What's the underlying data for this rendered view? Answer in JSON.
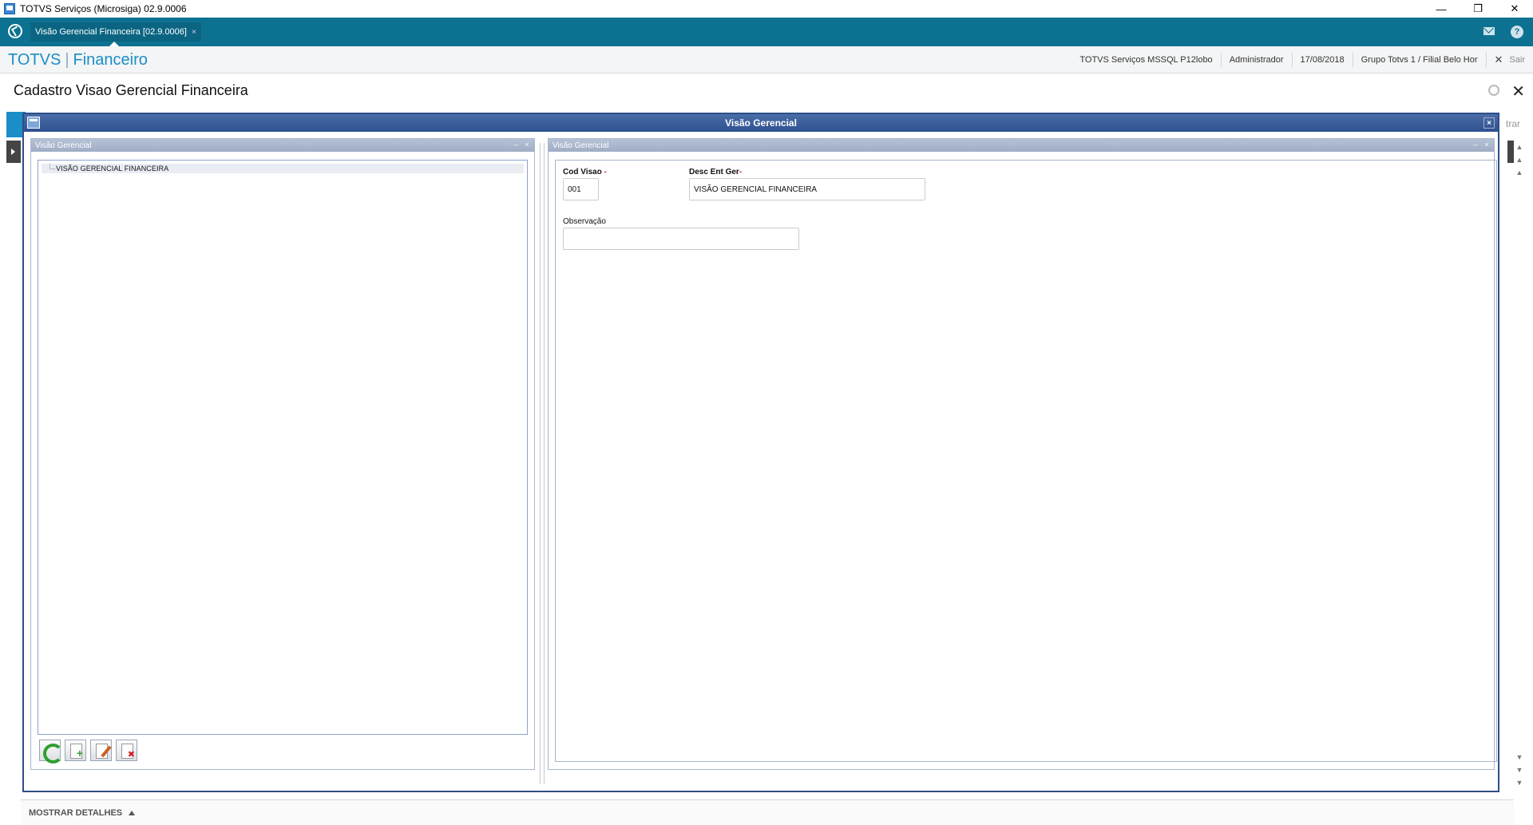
{
  "window": {
    "title": "TOTVS Serviços (Microsiga) 02.9.0006",
    "minimize": "—",
    "restore": "❐",
    "close": "✕"
  },
  "tabs": [
    {
      "label": "Visão Gerencial Financeira [02.9.0006]",
      "close": "×"
    }
  ],
  "header": {
    "brand_main": "TOTVS",
    "brand_sep": "|",
    "brand_module": "Financeiro",
    "environment": "TOTVS Serviços MSSQL P12lobo",
    "user": "Administrador",
    "date": "17/08/2018",
    "branch": "Grupo Totvs 1 / Filial Belo Hor",
    "logout_icon": "✕",
    "logout_label": "Sair",
    "help_label": "?"
  },
  "page": {
    "title": "Cadastro Visao Gerencial Financeira",
    "close": "✕",
    "background_button_text": "trar"
  },
  "dialog": {
    "title": "Visão Gerencial",
    "close": "×",
    "left_panel": {
      "title": "Visão Gerencial",
      "minimize": "–",
      "close": "×",
      "tree_items": [
        "VISÃO GERENCIAL FINANCEIRA"
      ]
    },
    "right_panel": {
      "title": "Visão Gerencial",
      "minimize": "–",
      "close": "×",
      "fields": {
        "cod_visao": {
          "label": "Cod Visao",
          "value": "001"
        },
        "desc_ent_ger": {
          "label": "Desc Ent Ger",
          "value": "VISÃO GERENCIAL FINANCEIRA"
        },
        "observacao": {
          "label": "Observação",
          "value": ""
        }
      },
      "required_marker": "-"
    }
  },
  "footer": {
    "details_label": "MOSTRAR DETALHES"
  },
  "colors": {
    "tabbar": "#0d7291",
    "brand": "#1b8ec7",
    "dialog_title": "#2e5090"
  }
}
